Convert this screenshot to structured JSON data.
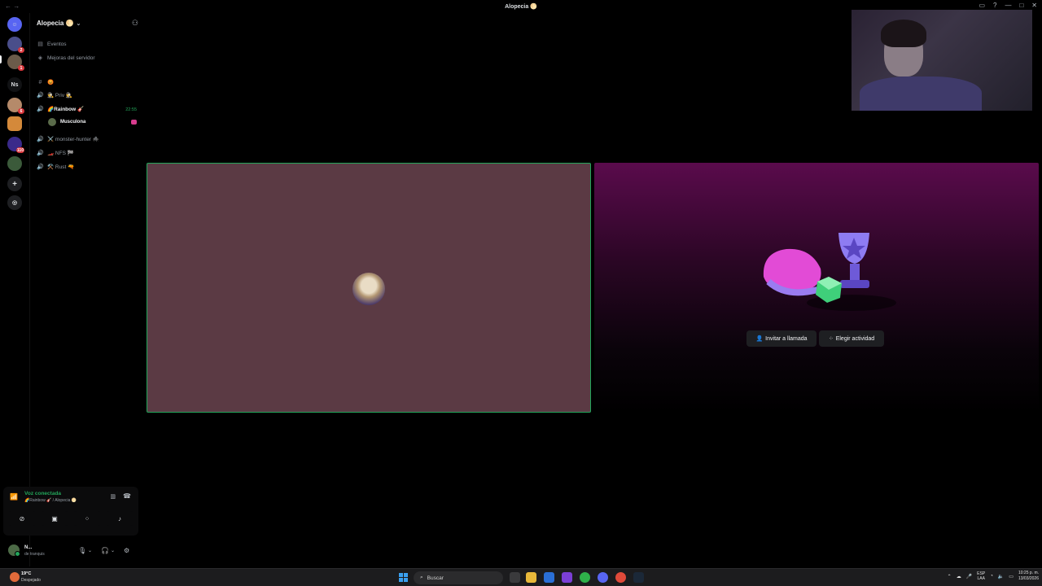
{
  "window": {
    "title": "Alopecia 🌕"
  },
  "rail": {
    "servers": [
      {
        "kind": "home",
        "label": "",
        "badge": ""
      },
      {
        "kind": "server",
        "label": "",
        "badge": "2"
      },
      {
        "kind": "server",
        "label": "",
        "badge": "1"
      },
      {
        "kind": "server",
        "label": "Ns",
        "badge": ""
      },
      {
        "kind": "server",
        "label": "",
        "badge": "6"
      },
      {
        "kind": "server",
        "label": "",
        "badge": ""
      },
      {
        "kind": "server",
        "label": "",
        "badge": "110"
      },
      {
        "kind": "server",
        "label": "",
        "badge": ""
      }
    ]
  },
  "server": {
    "name": "Alopecia 🌕"
  },
  "menu": {
    "events": "Eventos",
    "boosts": "Mejoras del servidor"
  },
  "channels": [
    {
      "icon": "hash",
      "name": "😡"
    },
    {
      "icon": "speaker",
      "name": "🕵️ Priv 🕵️"
    },
    {
      "icon": "speaker",
      "name": "🌈Rainbow 🎸"
    },
    {
      "icon": "speaker",
      "name": "⚔️ monster-hunter 🕷️"
    },
    {
      "icon": "speaker",
      "name": "🏎️ NFS 🏁"
    },
    {
      "icon": "speaker",
      "name": "⚒️ Rust 🔫"
    }
  ],
  "voice_timer": "22:55",
  "member": {
    "name": "Musculona"
  },
  "voice": {
    "status": "Voz conectada",
    "location": "🌈Rainbow 🎸 / Alopecia 🌕"
  },
  "user": {
    "name": "N...",
    "status": "de tranquis"
  },
  "stage": {
    "invite_label": "Invitar a llamada",
    "activity_label": "Elegir actividad"
  },
  "taskbar": {
    "weather_temp": "19°C",
    "weather_cond": "Despejado",
    "search_placeholder": "Buscar",
    "lang_1": "ESP",
    "lang_2": "LAA",
    "time": "10:25 p. m.",
    "date": "13/03/2026"
  },
  "colors": {
    "accent_green": "#23a55a",
    "tile_bg": "#5b3a44",
    "badge_red": "#da373c"
  }
}
